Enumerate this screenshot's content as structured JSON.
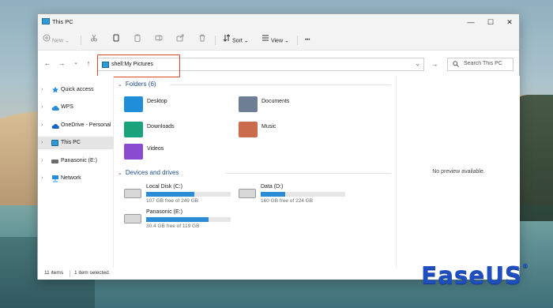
{
  "window": {
    "title": "This PC",
    "min_glyph": "—",
    "max_glyph": "☐",
    "close_glyph": "✕"
  },
  "toolbar": {
    "new_label": "New",
    "sort_label": "Sort",
    "view_label": "View",
    "more_glyph": "•••"
  },
  "address": {
    "path": "shell:My Pictures",
    "search_placeholder": "Search This PC"
  },
  "sidebar": {
    "items": [
      {
        "label": "Quick access",
        "icon": "star-icon"
      },
      {
        "label": "WPS",
        "icon": "cloud-icon"
      },
      {
        "label": "OneDrive - Personal",
        "icon": "onedrive-icon"
      },
      {
        "label": "This PC",
        "icon": "pc-icon",
        "selected": true
      },
      {
        "label": "Panasonic (E:)",
        "icon": "drive-icon"
      },
      {
        "label": "Network",
        "icon": "network-icon"
      }
    ]
  },
  "main": {
    "folders_title": "Folders (6)",
    "folders": [
      {
        "label": "Desktop",
        "icon": "desktop-folder-icon",
        "color": "#1e8fd8"
      },
      {
        "label": "Documents",
        "icon": "documents-folder-icon",
        "color": "#6d7f95"
      },
      {
        "label": "Downloads",
        "icon": "downloads-folder-icon",
        "color": "#1aa37a"
      },
      {
        "label": "Music",
        "icon": "music-folder-icon",
        "color": "#c96b4c"
      },
      {
        "label": "Videos",
        "icon": "videos-folder-icon",
        "color": "#8a4bd1"
      }
    ],
    "drives_title": "Devices and drives",
    "drives": [
      {
        "label": "Local Disk (C:)",
        "free": "107 GB free of 249 GB",
        "used_fraction": 0.57
      },
      {
        "label": "Data (D:)",
        "free": "160 GB free of 224 GB",
        "used_fraction": 0.29
      },
      {
        "label": "Panasonic (E:)",
        "free": "30.4 GB free of 119 GB",
        "used_fraction": 0.74
      }
    ]
  },
  "preview": {
    "message": "No preview available."
  },
  "status": {
    "items_count": "11 items",
    "selected": "1 item selected"
  },
  "watermark": {
    "text": "EaseUS",
    "reg": "®"
  },
  "colors": {
    "accent": "#2a8bd6",
    "highlight_box": "#d9482b",
    "section_title": "#1d4e89"
  }
}
